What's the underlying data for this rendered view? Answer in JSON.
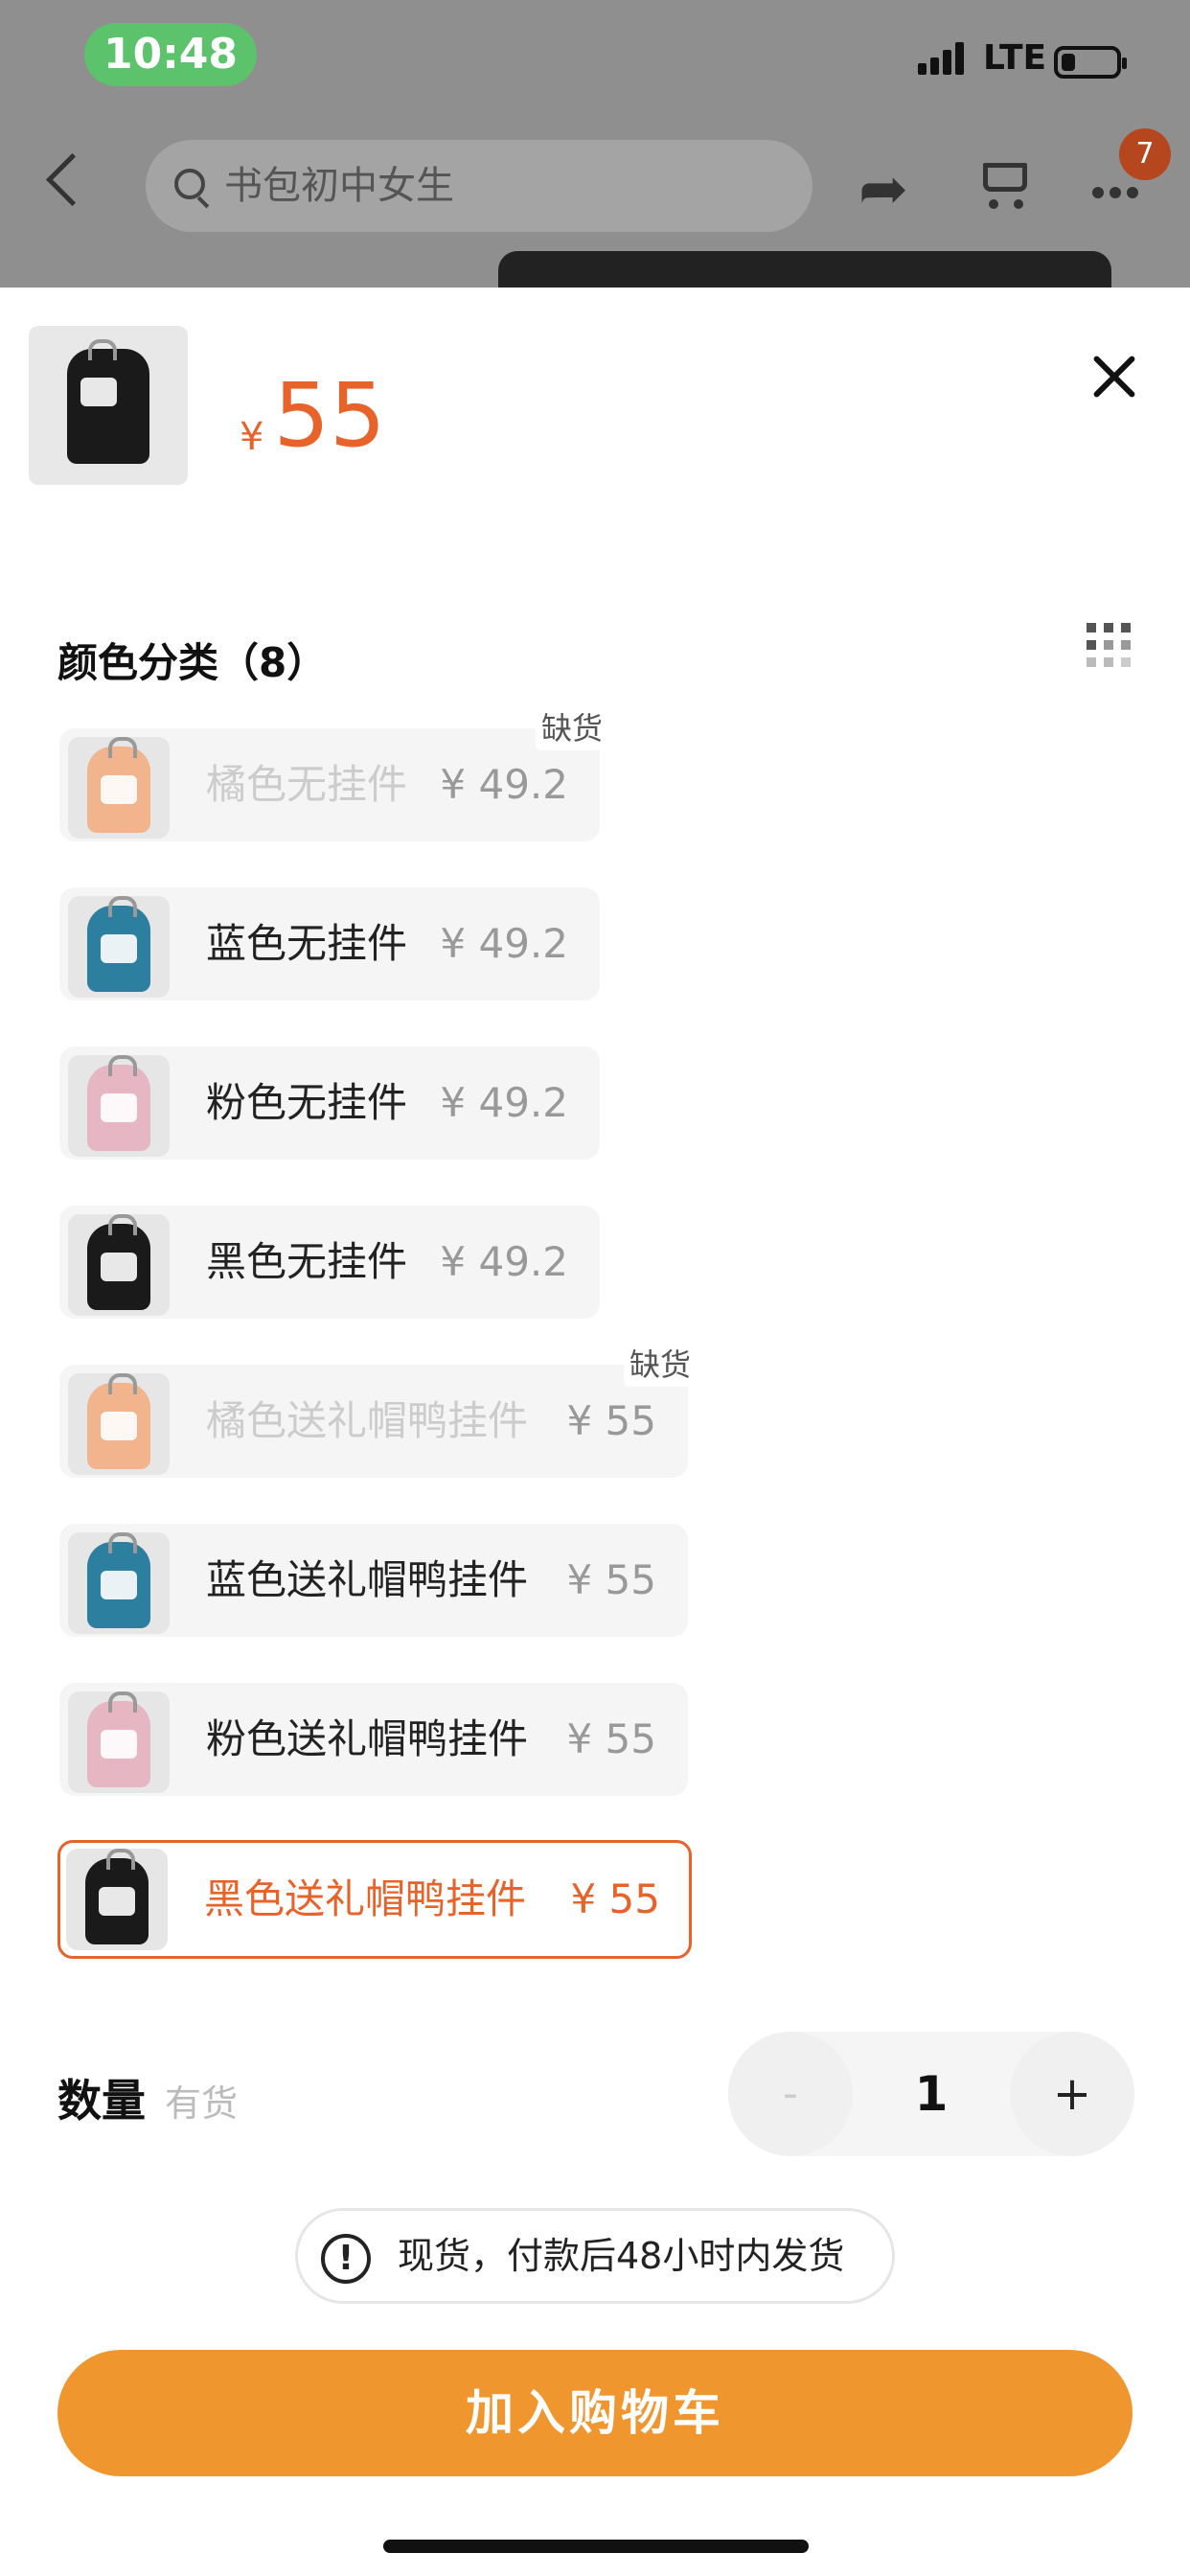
{
  "status_bar": {
    "time": "10:48",
    "network": "LTE"
  },
  "nav": {
    "search_placeholder": "书包初中女生",
    "more_badge": "7"
  },
  "product": {
    "currency": "¥",
    "price": "55"
  },
  "variants_section": {
    "title": "颜色分类（8）",
    "items": [
      {
        "name": "橘色无挂件",
        "price": "¥ 49.2",
        "tag": "缺货",
        "out_of_stock": true,
        "color": "#f2b48c"
      },
      {
        "name": "蓝色无挂件",
        "price": "¥ 49.2",
        "tag": "",
        "out_of_stock": false,
        "color": "#2d7fa0"
      },
      {
        "name": "粉色无挂件",
        "price": "¥ 49.2",
        "tag": "",
        "out_of_stock": false,
        "color": "#e6b6c2"
      },
      {
        "name": "黑色无挂件",
        "price": "¥ 49.2",
        "tag": "",
        "out_of_stock": false,
        "color": "#1a1a1a"
      },
      {
        "name": "橘色送礼帽鸭挂件",
        "price": "¥ 55",
        "tag": "缺货",
        "out_of_stock": true,
        "color": "#f2b48c"
      },
      {
        "name": "蓝色送礼帽鸭挂件",
        "price": "¥ 55",
        "tag": "",
        "out_of_stock": false,
        "color": "#2d7fa0"
      },
      {
        "name": "粉色送礼帽鸭挂件",
        "price": "¥ 55",
        "tag": "",
        "out_of_stock": false,
        "color": "#e6b6c2"
      },
      {
        "name": "黑色送礼帽鸭挂件",
        "price": "¥ 55",
        "tag": "",
        "out_of_stock": false,
        "selected": true,
        "color": "#1a1a1a"
      }
    ]
  },
  "quantity": {
    "label": "数量",
    "stock": "有货",
    "minus": "-",
    "value": "1",
    "plus": "+"
  },
  "notice": {
    "icon": "!",
    "text": "现货，付款后48小时内发货"
  },
  "add_to_cart": {
    "label": "加入购物车"
  },
  "colors": {
    "accent": "#e8632a",
    "button": "#f0962f"
  }
}
